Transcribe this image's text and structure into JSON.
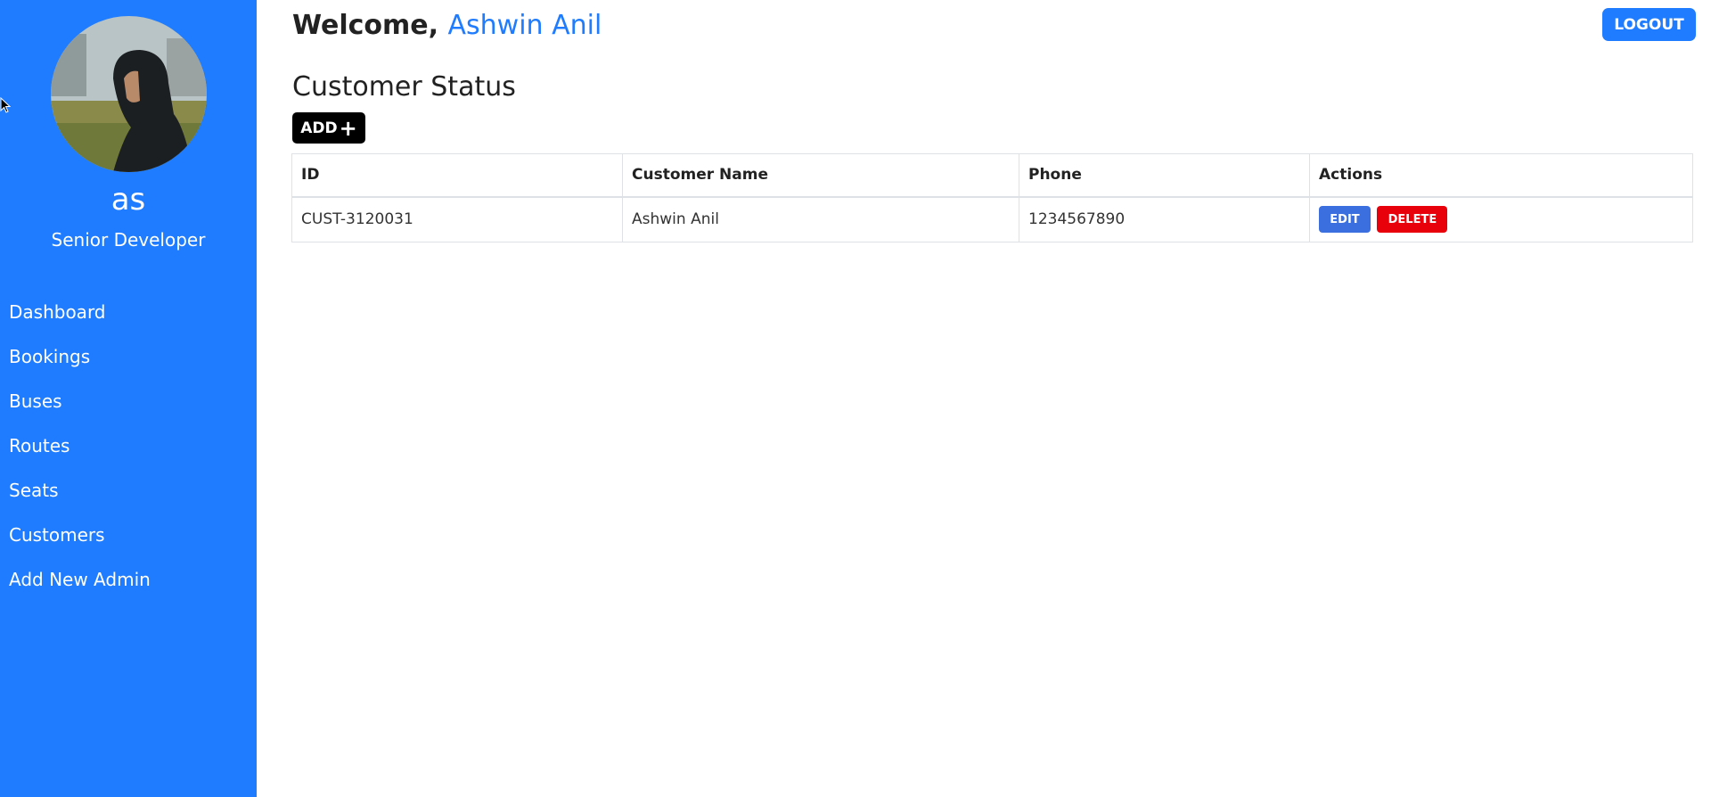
{
  "sidebar": {
    "profile": {
      "name": "as",
      "role": "Senior Developer"
    },
    "items": [
      {
        "label": "Dashboard"
      },
      {
        "label": "Bookings"
      },
      {
        "label": "Buses"
      },
      {
        "label": "Routes"
      },
      {
        "label": "Seats"
      },
      {
        "label": "Customers"
      },
      {
        "label": "Add New Admin"
      }
    ]
  },
  "header": {
    "welcome_prefix": "Welcome, ",
    "user_name": "Ashwin Anil",
    "logout_label": "LOGOUT"
  },
  "main": {
    "title": "Customer Status",
    "add_label": "ADD",
    "add_icon": "plus-icon",
    "table": {
      "columns": [
        "ID",
        "Customer Name",
        "Phone",
        "Actions"
      ],
      "rows": [
        {
          "id": "CUST-3120031",
          "name": "Ashwin Anil",
          "phone": "1234567890",
          "edit_label": "EDIT",
          "delete_label": "DELETE"
        }
      ]
    }
  },
  "colors": {
    "accent": "#1f7cff",
    "edit": "#3b6fe0",
    "delete": "#e8000b"
  }
}
